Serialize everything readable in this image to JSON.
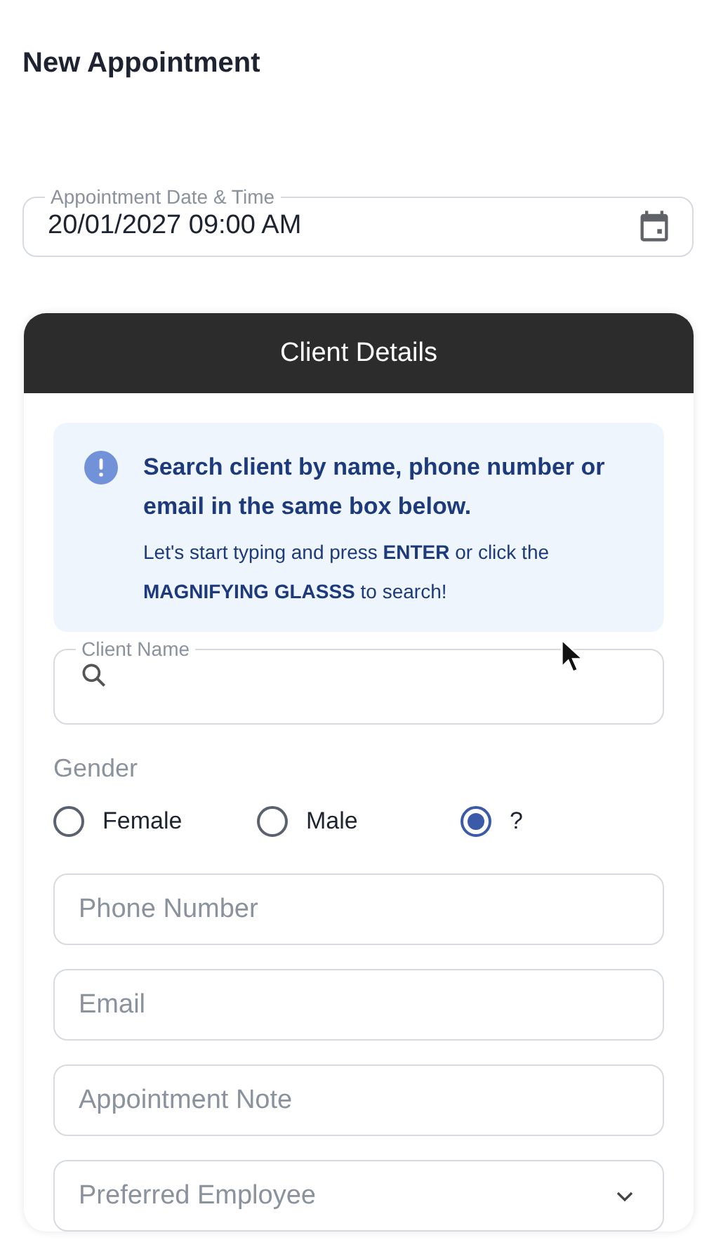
{
  "title": "New Appointment",
  "date_field": {
    "label": "Appointment Date & Time",
    "value": "20/01/2027 09:00 AM"
  },
  "client_card": {
    "header": "Client Details",
    "info": {
      "heading": "Search client by name, phone number or email in the same box below.",
      "text": "Let's start typing and press **ENTER** or click the **MAGNIFYING GLASSS** to search!"
    },
    "client_name": {
      "label": "Client Name"
    },
    "gender": {
      "label": "Gender",
      "options": [
        {
          "label": "Female",
          "selected": false
        },
        {
          "label": "Male",
          "selected": false
        },
        {
          "label": "?",
          "selected": true
        }
      ]
    },
    "fields": [
      {
        "kind": "input",
        "placeholder": "Phone Number"
      },
      {
        "kind": "input",
        "placeholder": "Email"
      },
      {
        "kind": "input",
        "placeholder": "Appointment Note"
      },
      {
        "kind": "select",
        "placeholder": "Preferred Employee"
      }
    ]
  }
}
